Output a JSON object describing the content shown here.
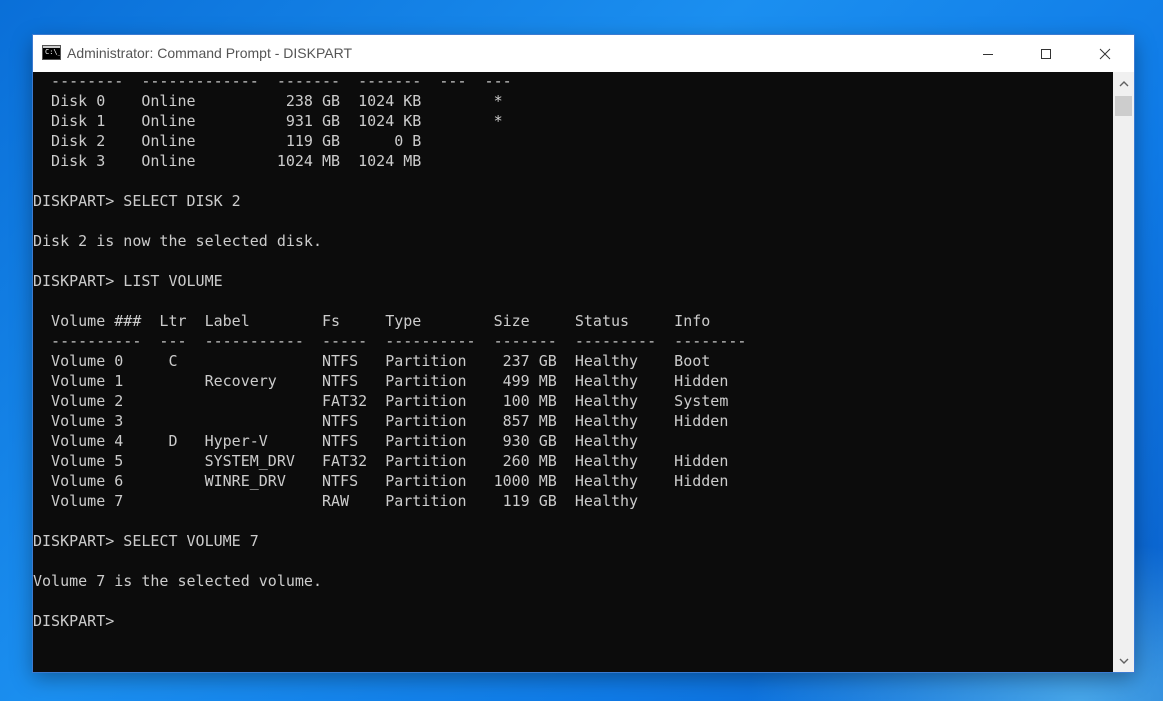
{
  "window": {
    "title": "Administrator: Command Prompt - DISKPART",
    "icon_text": "C:\\_"
  },
  "icons": {
    "app": "command-prompt-icon",
    "minimize": "minimize-icon",
    "maximize": "maximize-icon",
    "close": "close-icon",
    "scroll_up": "chevron-up-icon",
    "scroll_down": "chevron-down-icon"
  },
  "colors": {
    "console_bg": "#0c0c0c",
    "console_text": "#cccccc",
    "titlebar_bg": "#ffffff",
    "desktop": "#0f7ae6"
  },
  "console": {
    "lines": [
      "  --------  -------------  -------  -------  ---  ---",
      "  Disk 0    Online          238 GB  1024 KB        *",
      "  Disk 1    Online          931 GB  1024 KB        *",
      "  Disk 2    Online          119 GB      0 B",
      "  Disk 3    Online         1024 MB  1024 MB",
      "",
      "DISKPART> SELECT DISK 2",
      "",
      "Disk 2 is now the selected disk.",
      "",
      "DISKPART> LIST VOLUME",
      "",
      "  Volume ###  Ltr  Label        Fs     Type        Size     Status     Info",
      "  ----------  ---  -----------  -----  ----------  -------  ---------  --------",
      "  Volume 0     C                NTFS   Partition    237 GB  Healthy    Boot",
      "  Volume 1         Recovery     NTFS   Partition    499 MB  Healthy    Hidden",
      "  Volume 2                      FAT32  Partition    100 MB  Healthy    System",
      "  Volume 3                      NTFS   Partition    857 MB  Healthy    Hidden",
      "  Volume 4     D   Hyper-V      NTFS   Partition    930 GB  Healthy",
      "  Volume 5         SYSTEM_DRV   FAT32  Partition    260 MB  Healthy    Hidden",
      "  Volume 6         WINRE_DRV    NTFS   Partition   1000 MB  Healthy    Hidden",
      "  Volume 7                      RAW    Partition    119 GB  Healthy",
      "",
      "DISKPART> SELECT VOLUME 7",
      "",
      "Volume 7 is the selected volume.",
      "",
      "DISKPART> "
    ]
  }
}
